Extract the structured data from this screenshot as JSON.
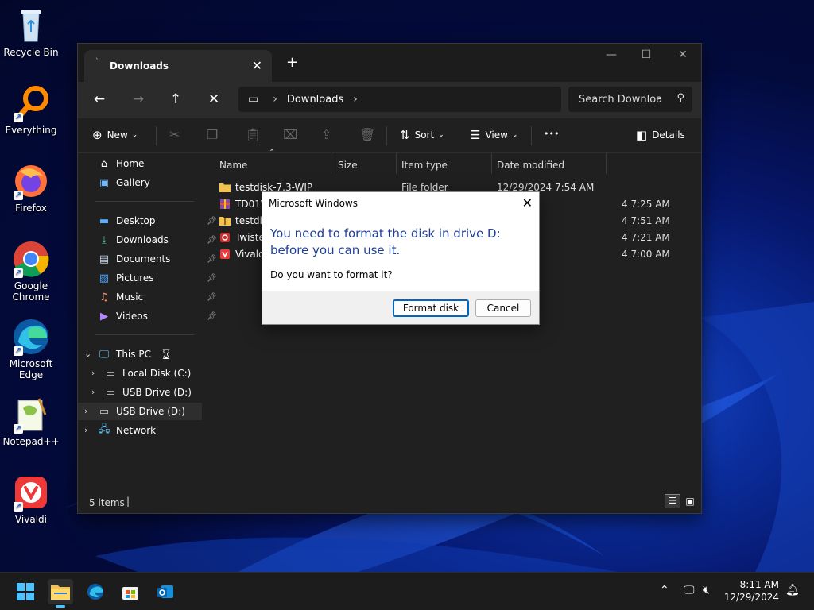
{
  "desktop": {
    "icons": [
      {
        "label": "Recycle Bin"
      },
      {
        "label": "Everything"
      },
      {
        "label": "Firefox"
      },
      {
        "label": "Google Chrome"
      },
      {
        "label": "Microsoft Edge"
      },
      {
        "label": "Notepad++"
      },
      {
        "label": "Vivaldi"
      }
    ]
  },
  "explorer": {
    "tab_label": "Downloads",
    "tab_close": "✕",
    "new_tab": "+",
    "address": {
      "crumb": "Downloads"
    },
    "search_placeholder": "Search Downloa",
    "toolbar": {
      "new_label": "New",
      "sort_label": "Sort",
      "view_label": "View",
      "more_label": "•••",
      "details_label": "Details"
    },
    "nav": {
      "home": "Home",
      "gallery": "Gallery",
      "desktop": "Desktop",
      "downloads": "Downloads",
      "documents": "Documents",
      "pictures": "Pictures",
      "music": "Music",
      "videos": "Videos",
      "this_pc": "This PC",
      "local_disk": "Local Disk (C:)",
      "usb_drive_1": "USB Drive (D:)",
      "usb_drive_2": "USB Drive (D:)",
      "network": "Network"
    },
    "columns": {
      "name": "Name",
      "size": "Size",
      "type": "Item type",
      "date": "Date modified"
    },
    "files": [
      {
        "name": "testdisk-7.3-WIP",
        "type": "File folder",
        "date": "12/29/2024 7:54 AM"
      },
      {
        "name": "TD01V",
        "type": "",
        "date": "4 7:25 AM"
      },
      {
        "name": "testdis",
        "type": "",
        "date": "4 7:51 AM"
      },
      {
        "name": "Twiste",
        "type": "",
        "date": "4 7:21 AM"
      },
      {
        "name": "Vivald",
        "type": "",
        "date": "4 7:00 AM"
      }
    ],
    "status": "5 items"
  },
  "dialog": {
    "title": "Microsoft Windows",
    "close": "✕",
    "message": "You need to format the disk in drive D: before you can use it.",
    "question": "Do you want to format it?",
    "format_button": "Format disk",
    "cancel_button": "Cancel"
  },
  "taskbar": {
    "time": "8:11 AM",
    "date": "12/29/2024"
  },
  "colors": {
    "accent": "#0067c0",
    "dialog_message": "#1e3f99",
    "folder": "#f3c24f"
  }
}
